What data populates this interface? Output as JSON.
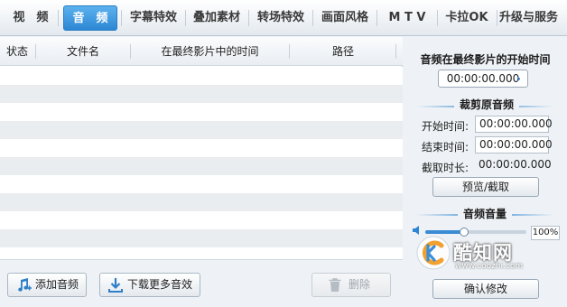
{
  "tabs": [
    {
      "label": "视　频",
      "active": false
    },
    {
      "label": "音　频",
      "active": true
    },
    {
      "label": "字幕特效",
      "active": false
    },
    {
      "label": "叠加素材",
      "active": false
    },
    {
      "label": "转场特效",
      "active": false
    },
    {
      "label": "画面风格",
      "active": false
    },
    {
      "label": "M T V",
      "active": false
    },
    {
      "label": "卡拉OK",
      "active": false
    },
    {
      "label": "升级与服务",
      "active": false
    }
  ],
  "file_list": {
    "columns": [
      "状态",
      "文件名",
      "在最终影片中的时间",
      "路径"
    ],
    "rows": []
  },
  "bottom_buttons": {
    "add_audio": "添加音频",
    "download_more": "下载更多音效",
    "delete": "删除"
  },
  "right_panel": {
    "start_time_title": "音频在最终影片的开始时间",
    "start_time_value": "00:00:00.000",
    "crop_title": "裁剪原音频",
    "start_label": "开始时间:",
    "start_value": "00:00:00.000",
    "end_label": "结束时间:",
    "end_value": "00:00:00.000",
    "duration_label": "截取时长:",
    "duration_value": "00:00:00.000",
    "preview_button": "预览/截取",
    "volume_title": "音频音量",
    "volume_value": "100%",
    "volume_level": 1.0,
    "confirm_button": "确认修改"
  },
  "watermark": {
    "brand": "酷知网",
    "url": "www.coozhi.com"
  },
  "colors": {
    "accent": "#2c86d4",
    "tab_active_text": "#ffffff"
  }
}
